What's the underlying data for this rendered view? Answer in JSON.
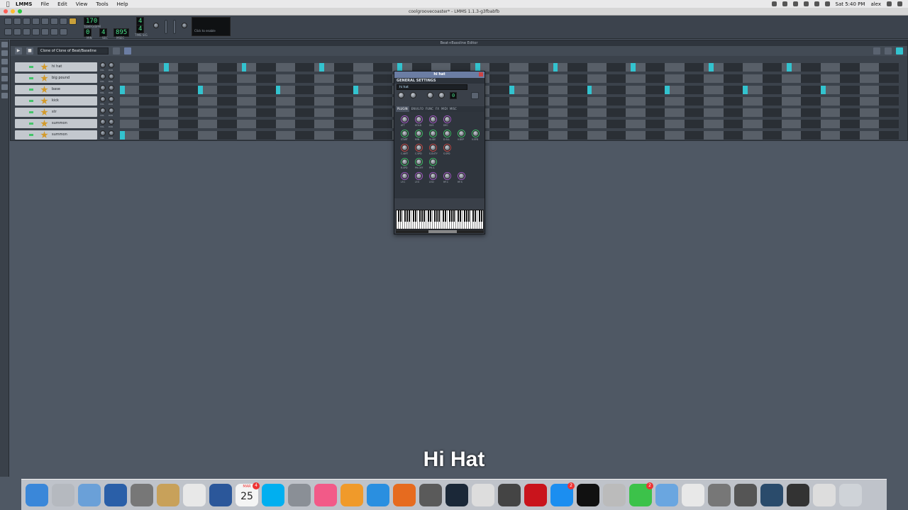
{
  "menubar": {
    "app": "LMMS",
    "items": [
      "File",
      "Edit",
      "View",
      "Tools",
      "Help"
    ],
    "clock": "Sat 5:40 PM",
    "user": "alex"
  },
  "window": {
    "title": "coolgroovecoaster* - LMMS 1.1.3-g3fbabfb"
  },
  "toolbar": {
    "tempo": "170",
    "tempo_label": "TEMPO/BPM",
    "timesig_top": "4",
    "timesig_bottom": "4",
    "timesig_label": "TIME SIG",
    "time_min": "0",
    "time_sec": "4",
    "time_msec": "895",
    "time_labels": [
      "MIN",
      "SEC",
      "MSEC"
    ],
    "cpu_text": "Click to enable"
  },
  "bbeditor": {
    "title": "Beat+Bassline Editor",
    "selected": "Clone of Clone of Beat/Baseline",
    "vol_label": "VOL",
    "pan_label": "PAN",
    "tracks": [
      {
        "name": "hi hat",
        "on": [
          9,
          25,
          41,
          57,
          73,
          89,
          105,
          121,
          137
        ]
      },
      {
        "name": "big pound",
        "on": []
      },
      {
        "name": "base",
        "on": [
          0,
          16,
          32,
          48,
          64,
          80,
          96,
          112,
          128,
          144
        ]
      },
      {
        "name": "kick",
        "on": []
      },
      {
        "name": "str",
        "on": []
      },
      {
        "name": "summon",
        "on": []
      },
      {
        "name": "summon",
        "on": [
          0
        ]
      }
    ]
  },
  "plugin": {
    "title": "hi hat",
    "general_settings": "GENERAL SETTINGS",
    "instrument_name": "hi hat",
    "fx_channel": "0",
    "tabs": [
      "PLUGIN",
      "ENV/LFO",
      "FUNC",
      "FX",
      "MIDI",
      "MISC"
    ],
    "active_tab": "PLUGIN",
    "knob_rows": [
      [
        "ATT",
        "HOLD",
        "SUS",
        "DEC"
      ],
      [
        "START",
        "MIN",
        "SLIDE",
        "D.SLL",
        "V.DEP",
        "V.SPD"
      ],
      [
        "C.AMT",
        "C.SPD",
        "S.DUTY",
        "S.SPD"
      ],
      [
        "R.SPD",
        "PH.OFF",
        "PH.S."
      ],
      [
        "LF.C",
        "LF.S",
        "LF.D",
        "HF.C",
        "HF.S"
      ]
    ]
  },
  "subtitle": "Hi Hat",
  "dock": {
    "icons": [
      "finder-icon",
      "launchpad-icon",
      "preview-icon",
      "quicktime-icon",
      "calculator-icon",
      "contacts-icon",
      "photos-icon",
      "word-icon",
      "calendar-icon",
      "skype-icon",
      "system-preferences-icon",
      "itunes-icon",
      "ibooks-icon",
      "safari-icon",
      "firefox-icon",
      "imovie-icon",
      "steam-icon",
      "textedit-icon",
      "keyboard-viewer-icon",
      "lastpass-icon",
      "app-store-icon",
      "terminal-icon",
      "rocket-icon",
      "facetime-icon",
      "mail-icon",
      "photos2-icon",
      "disk-utility-icon",
      "screenshot-icon",
      "quicktime2-icon",
      "scanner-icon",
      "documents-icon",
      "trash-icon"
    ],
    "calendar_day": "25",
    "calendar_month": "MAR",
    "badges": {
      "calendar-icon": "4",
      "app-store-icon": "2",
      "facetime-icon": "2"
    },
    "colors": [
      "#3a87d9",
      "#b5b9bf",
      "#6aa0d8",
      "#2a5fa8",
      "#777",
      "#c8a15a",
      "#e8e8e8",
      "#2b579a",
      "#f4f4f4",
      "#00aff0",
      "#8a8f96",
      "#f25a88",
      "#f09a2a",
      "#2a8fe0",
      "#e66b1f",
      "#5a5a5a",
      "#1b2838",
      "#ddd",
      "#444",
      "#c9141c",
      "#1b8ef0",
      "#111",
      "#bbb",
      "#3cc24a",
      "#6aa6e0",
      "#e8e8e8",
      "#777",
      "#555",
      "#2a4b6b",
      "#333",
      "#ddd",
      "#cfd3d8"
    ]
  }
}
